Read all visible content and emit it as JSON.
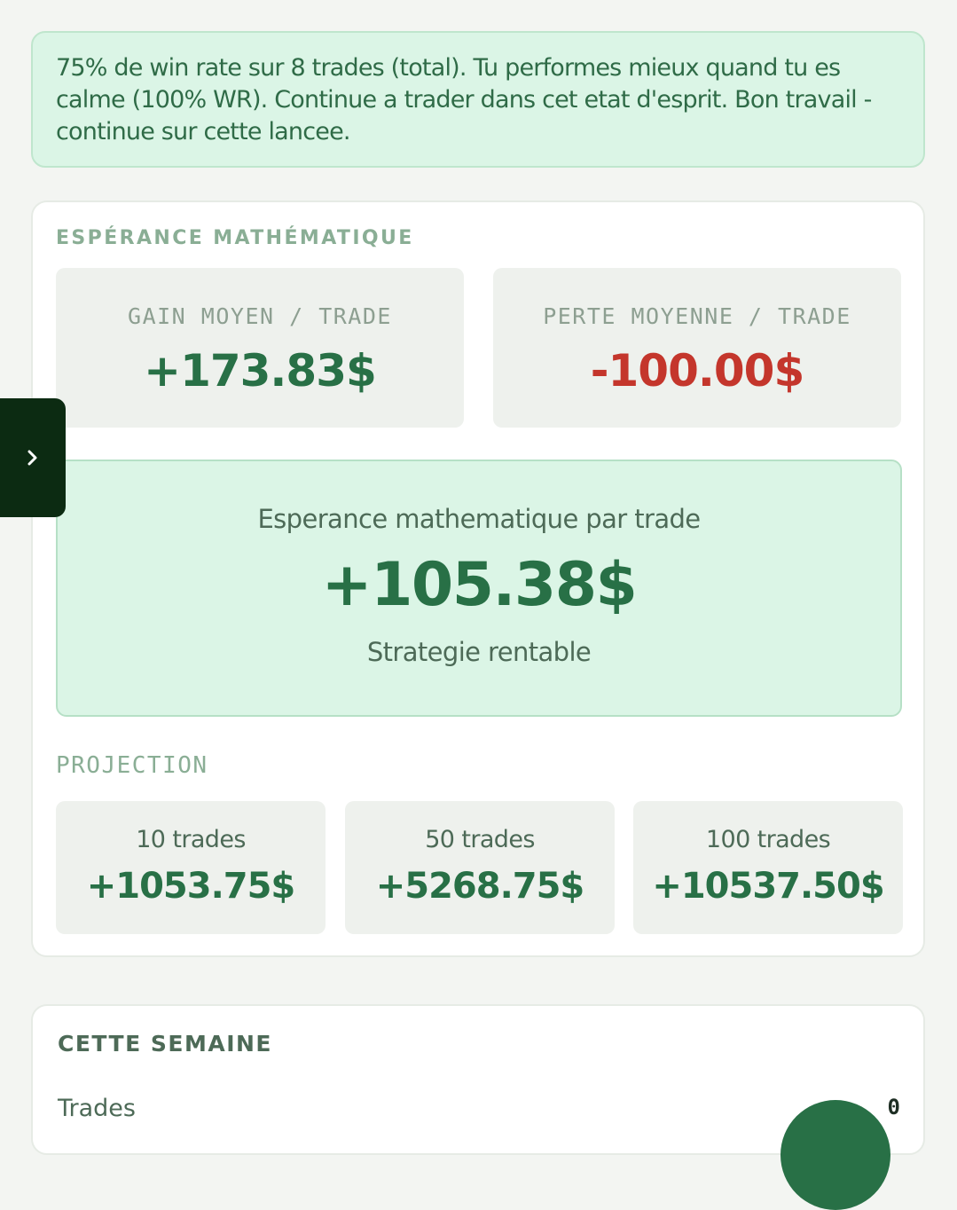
{
  "insight": {
    "text": "75% de win rate sur 8 trades (total). Tu performes mieux quand tu es calme (100% WR). Continue a trader dans cet etat d'esprit. Bon travail - continue sur cette lancee."
  },
  "expectancy": {
    "section_title": "ESPÉRANCE MATHÉMATIQUE",
    "avg_gain_label": "GAIN MOYEN / TRADE",
    "avg_gain_value": "+173.83$",
    "avg_loss_label": "PERTE MOYENNE / TRADE",
    "avg_loss_value": "-100.00$",
    "per_trade_label": "Esperance mathematique par trade",
    "per_trade_value": "+105.38$",
    "verdict": "Strategie rentable"
  },
  "projection": {
    "title": "PROJECTION",
    "items": [
      {
        "label": "10 trades",
        "value": "+1053.75$"
      },
      {
        "label": "50 trades",
        "value": "+5268.75$"
      },
      {
        "label": "100 trades",
        "value": "+10537.50$"
      }
    ]
  },
  "week": {
    "title": "CETTE SEMAINE",
    "trades_label": "Trades",
    "trades_value": "0"
  },
  "icons": {
    "drawer_toggle": "chevron-right-icon"
  },
  "colors": {
    "positive": "#287046",
    "negative": "#c4362c",
    "highlight_bg": "#dbf5e6",
    "drawer_bg": "#0c2b12"
  }
}
